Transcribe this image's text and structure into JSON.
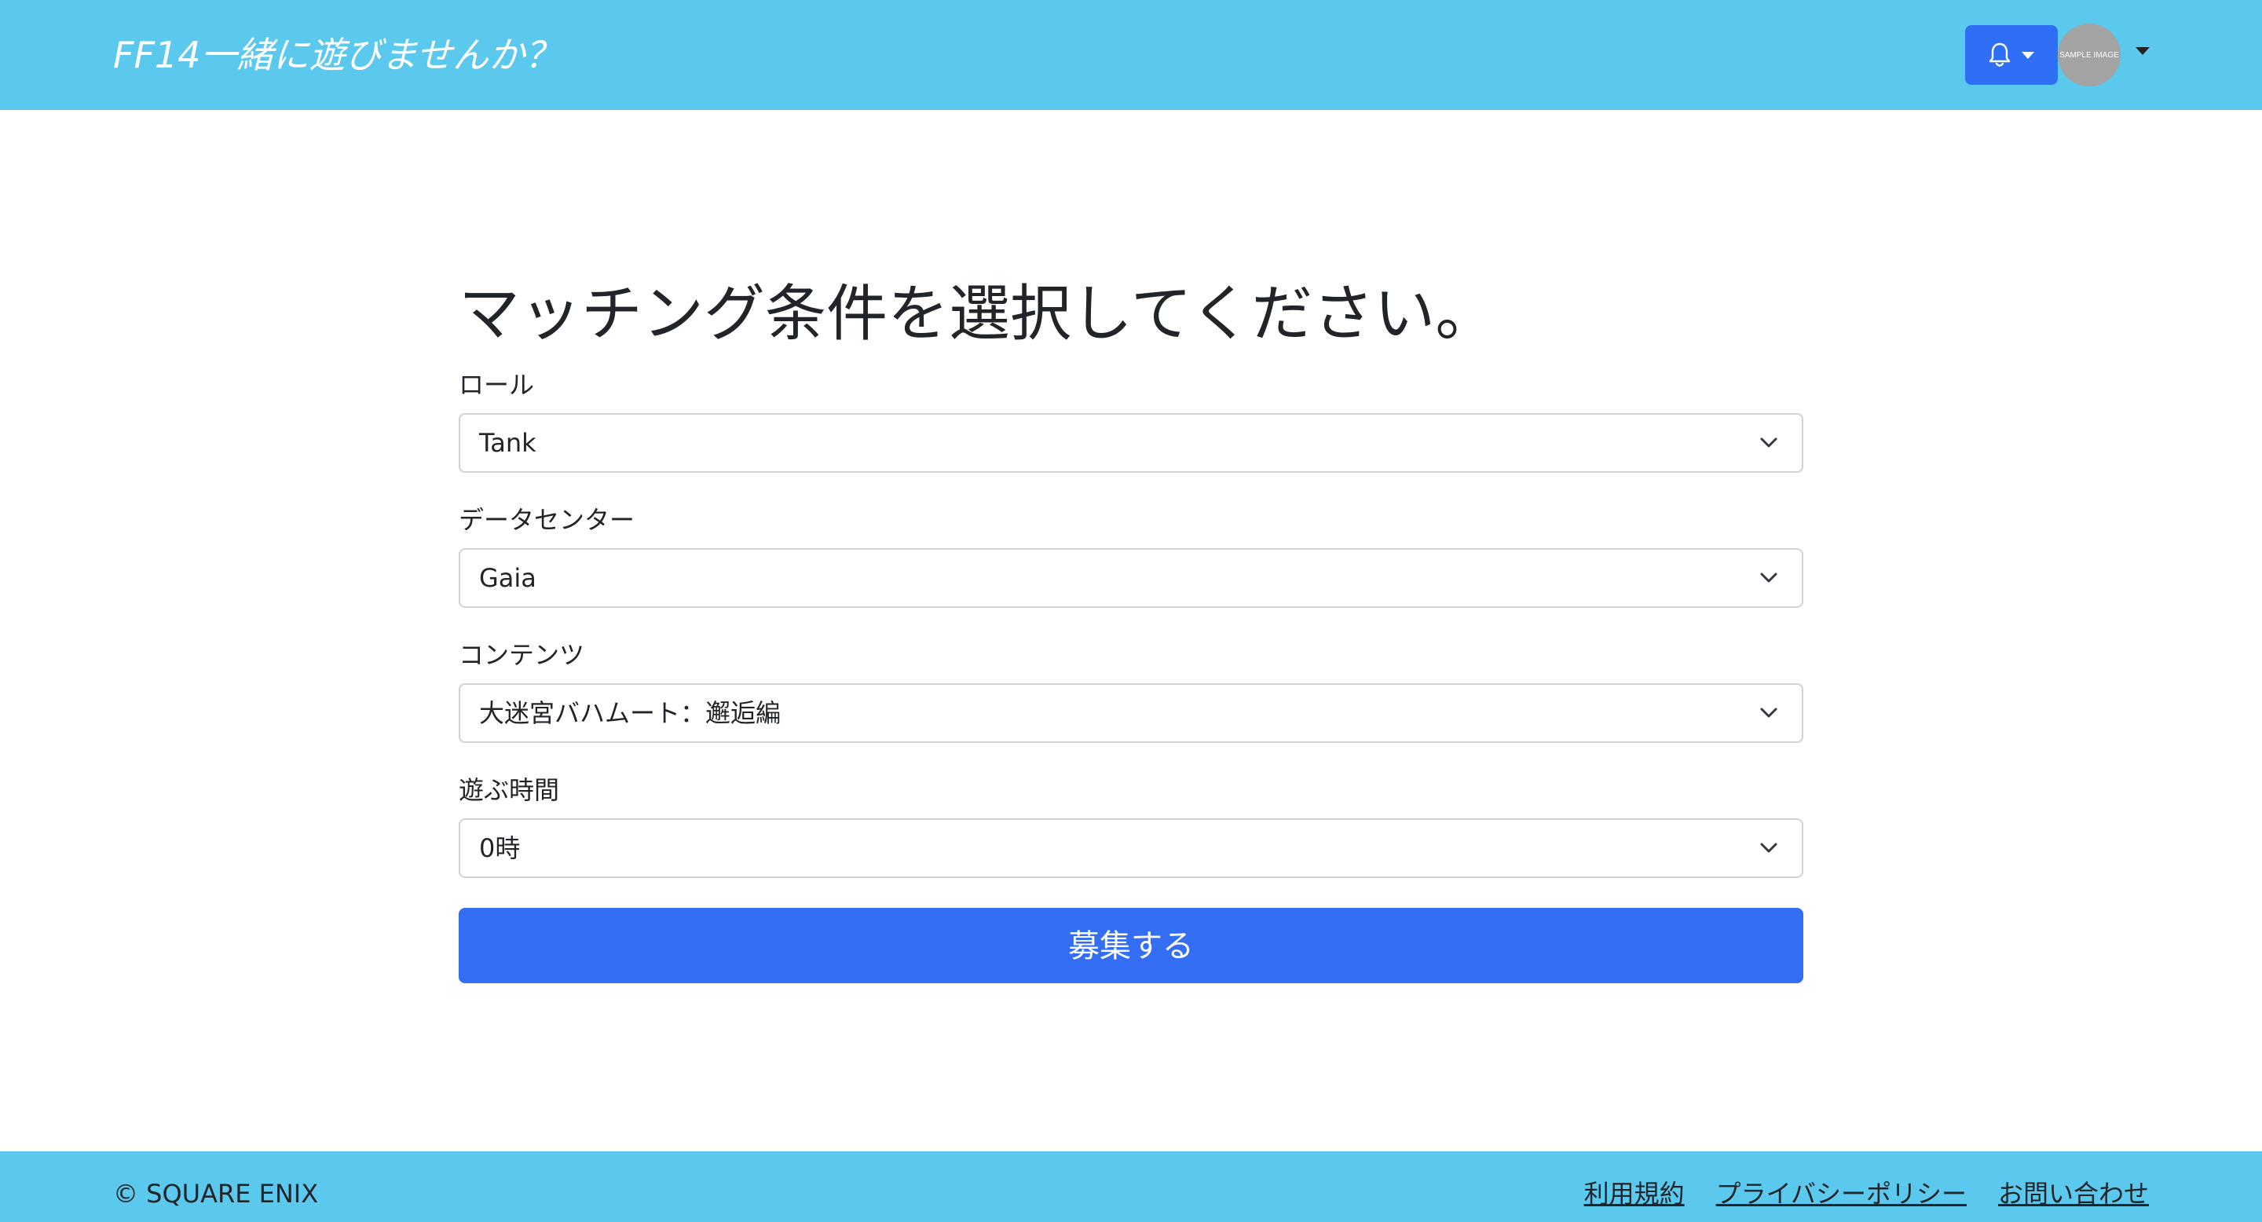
{
  "header": {
    "brand": "FF14一緒に遊びませんか？",
    "notification_icon": "bell-icon",
    "avatar_text": "SAMPLE IMAGE"
  },
  "form": {
    "title": "マッチング条件を選択してください。",
    "fields": [
      {
        "label": "ロール",
        "value": "Tank"
      },
      {
        "label": "データセンター",
        "value": "Gaia"
      },
      {
        "label": "コンテンツ",
        "value": "大迷宮バハムート：邂逅編"
      },
      {
        "label": "遊ぶ時間",
        "value": "0時"
      }
    ],
    "submit_label": "募集する"
  },
  "footer": {
    "copyright": "© SQUARE ENIX",
    "links": [
      "利用規約",
      "プライバシーポリシー",
      "お問い合わせ"
    ]
  },
  "colors": {
    "header_bg": "#5bc8ee",
    "primary": "#336ef4",
    "avatar_bg": "#a3a3a3"
  }
}
